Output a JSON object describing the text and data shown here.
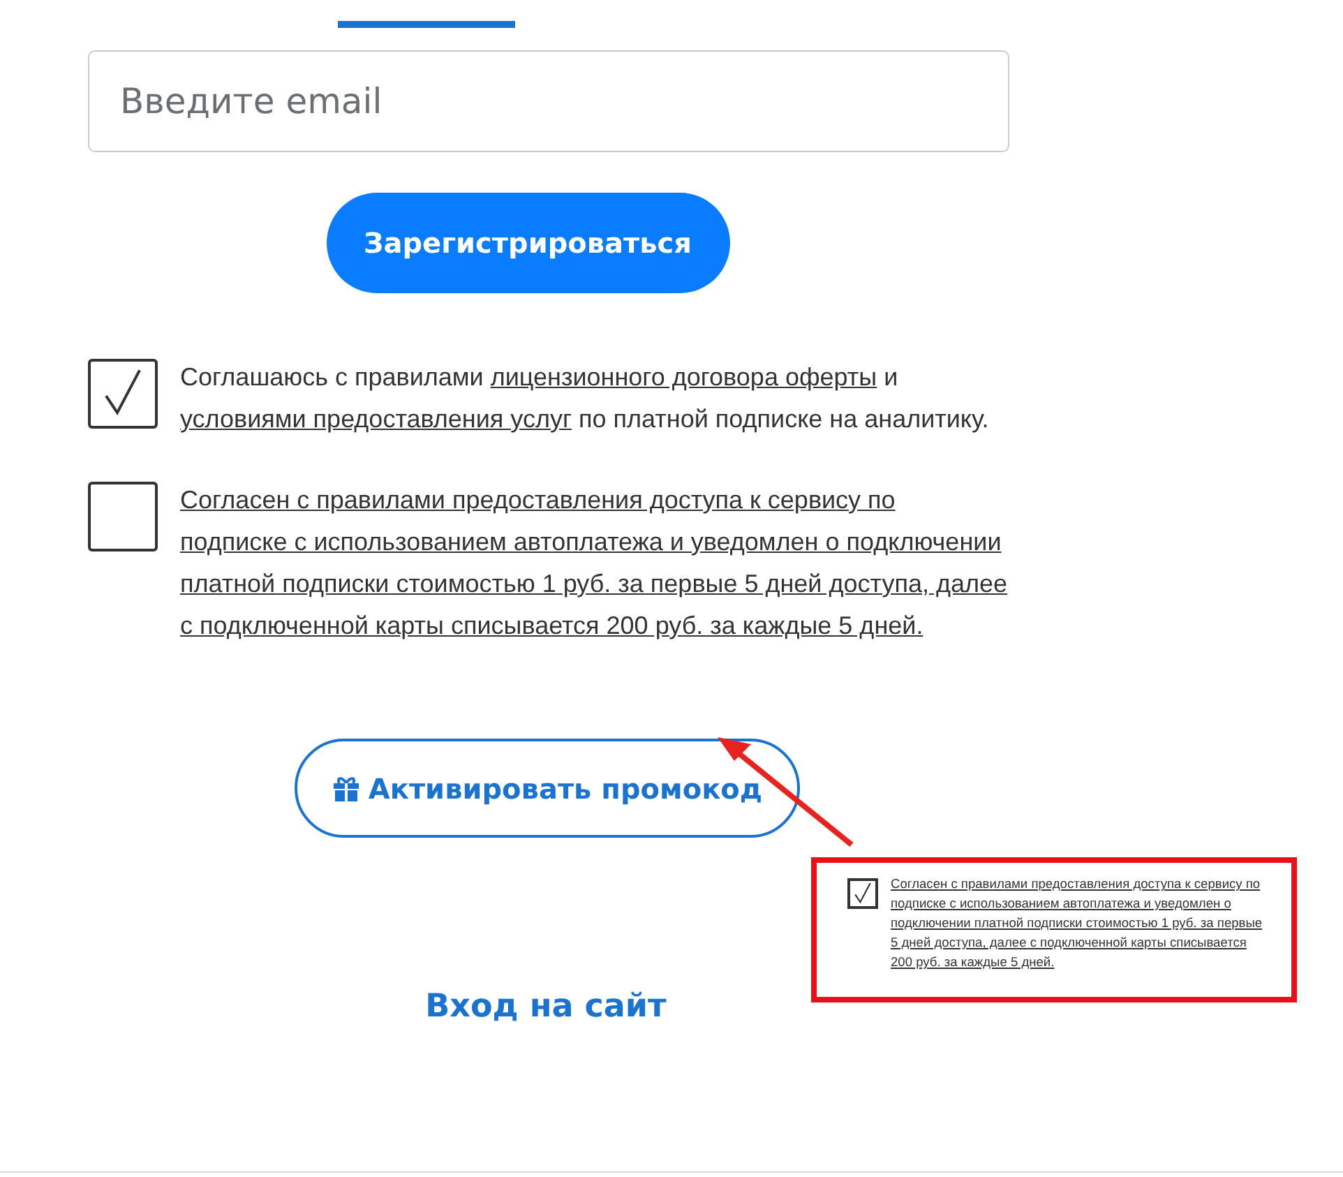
{
  "email_field": {
    "placeholder": "Введите email"
  },
  "register_button": "Зарегистрироваться",
  "consents": [
    {
      "checked": true,
      "parts": [
        {
          "text": "Соглашаюсь с правилами ",
          "link": false
        },
        {
          "text": "лицензионного договора оферты",
          "link": true
        },
        {
          "text": " и ",
          "link": false
        },
        {
          "text": "условиями предоставления услуг",
          "link": true
        },
        {
          "text": " по платной подписке на аналитику.",
          "link": false
        }
      ]
    },
    {
      "checked": false,
      "parts": [
        {
          "text": "Согласен с правилами предоставления доступа к сервису по подписке с использованием автоплатежа и уведомлен о подключении платной подписки стоимостью 1 руб. за первые 5 дней доступа, далее с подключенной карты списывается 200 руб. за каждые 5 дней.",
          "link": true
        }
      ]
    }
  ],
  "promo_button": "Активировать промокод",
  "callout": {
    "checked": true,
    "text": "Согласен с правилами предоставления доступа к сервису по подписке с использованием автоплатежа и уведомлен о подключении платной подписки стоимостью 1 руб. за первые 5 дней доступа, далее с подключенной карты списывается 200 руб. за каждые 5 дней."
  },
  "login_link": "Вход на сайт"
}
